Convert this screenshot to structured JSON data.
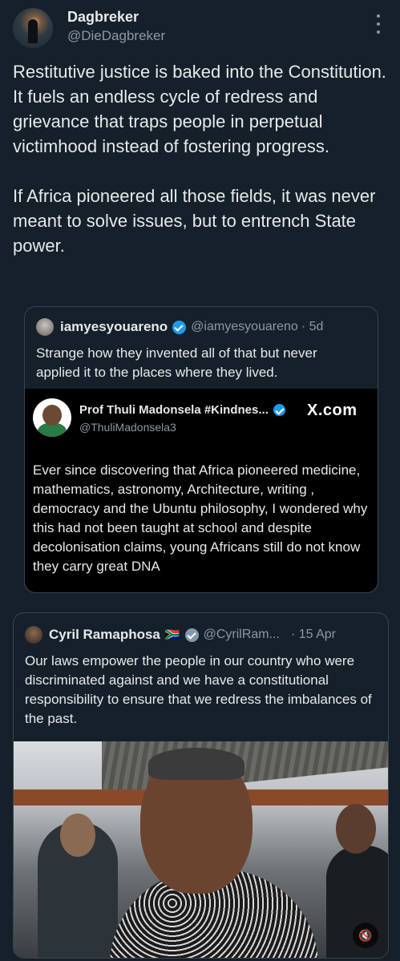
{
  "author": {
    "display_name": "Dagbreker",
    "handle": "@DieDagbreker"
  },
  "tweet": {
    "text": "Restitutive justice is baked into the Constitution. It fuels an endless cycle of redress and grievance that traps people in perpetual victimhood instead of fostering progress.\n\nIf Africa pioneered all those fields, it was never meant to solve issues, but to entrench State power."
  },
  "quote_tweet": {
    "display_name": "iamyesyouareno",
    "handle": "@iamyesyouareno",
    "time": "· 5d",
    "text": "Strange how they invented all of that but never applied it to the places where they lived.",
    "embed": {
      "display_name": "Prof Thuli Madonsela #Kindnes...",
      "handle": "@ThuliMadonsela3",
      "brand": "X.com",
      "text": "Ever since discovering that Africa pioneered medicine, mathematics, astronomy, Architecture, writing , democracy and the Ubuntu philosophy, I wondered why this had not been taught at school and despite  decolonisation claims, young Africans still do not know they carry great DNA"
    }
  },
  "second_quote": {
    "display_name": "Cyril Ramaphosa",
    "flag": "🇿🇦",
    "handle": "@CyrilRam...",
    "time": "· 15 Apr",
    "text": "Our laws empower the people in our country who were discriminated against and we have a constitutional responsibility to ensure that we redress the imbalances of the past."
  },
  "icons": {
    "more": "more-vertical-icon",
    "verified": "verified-badge-icon",
    "mute": "speaker-muted-icon"
  },
  "colors": {
    "background": "#15202b",
    "text": "#e7e9ea",
    "secondary": "#8b98a5",
    "verified": "#1d9bf0",
    "border": "#38444d"
  }
}
